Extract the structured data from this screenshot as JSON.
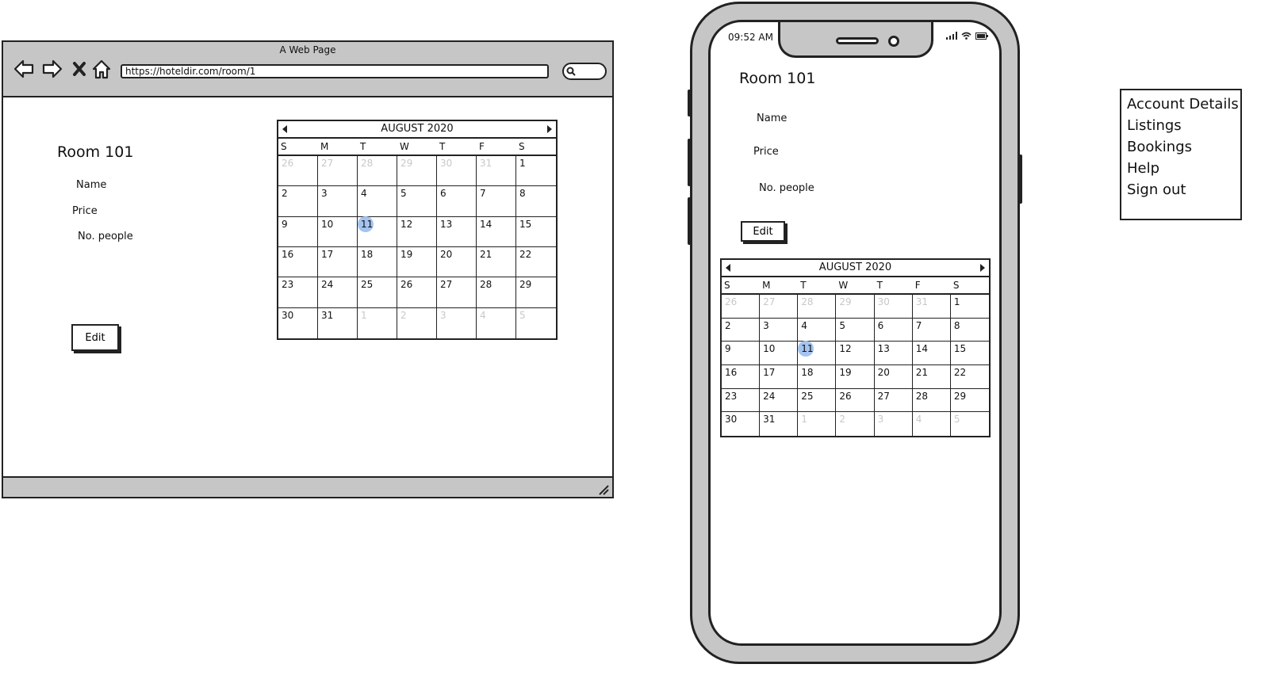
{
  "browser": {
    "title": "A Web Page",
    "url": "https://hoteldir.com/room/1"
  },
  "web_page": {
    "title": "Room 101",
    "fields": [
      "Name",
      "Price",
      "No. people"
    ],
    "edit_label": "Edit"
  },
  "phone": {
    "time": "09:52 AM",
    "title": "Room 101",
    "fields": [
      "Name",
      "Price",
      "No. people"
    ],
    "edit_label": "Edit"
  },
  "calendar": {
    "month_label": "AUGUST 2020",
    "weekdays": [
      "S",
      "M",
      "T",
      "W",
      "T",
      "F",
      "S"
    ],
    "selected_day": "11",
    "highlight_color": "#a4c3f0",
    "weeks": [
      [
        "26",
        "27",
        "28",
        "29",
        "30",
        "31",
        "1"
      ],
      [
        "2",
        "3",
        "4",
        "5",
        "6",
        "7",
        "8"
      ],
      [
        "9",
        "10",
        "11",
        "12",
        "13",
        "14",
        "15"
      ],
      [
        "16",
        "17",
        "18",
        "19",
        "20",
        "21",
        "22"
      ],
      [
        "23",
        "24",
        "25",
        "26",
        "27",
        "28",
        "29"
      ],
      [
        "30",
        "31",
        "1",
        "2",
        "3",
        "4",
        "5"
      ]
    ]
  },
  "menu": {
    "items": [
      "Account Details",
      "Listings",
      "Bookings",
      "Help",
      "Sign out"
    ]
  }
}
